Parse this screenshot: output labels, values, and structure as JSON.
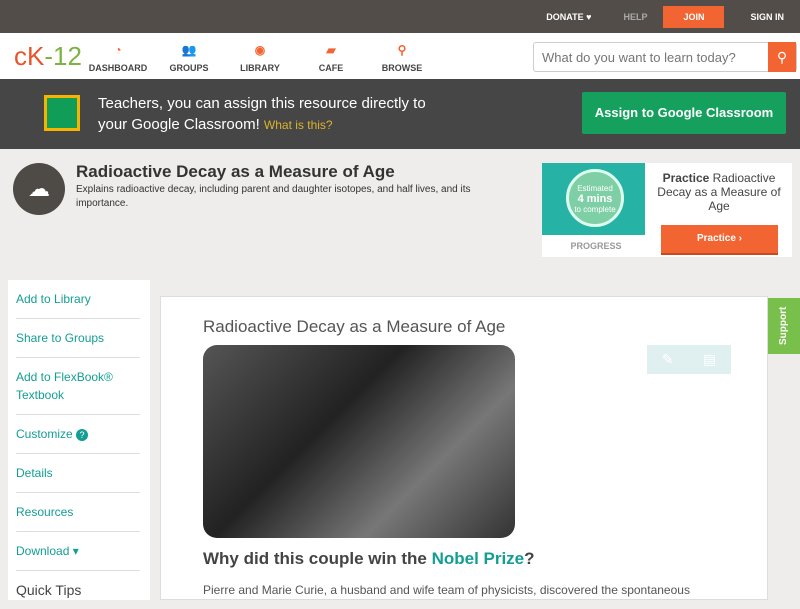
{
  "topbar": {
    "donate": "DONATE ♥",
    "help": "HELP",
    "join": "JOIN",
    "signin": "SIGN IN"
  },
  "logo": {
    "a": "cK",
    "b": "-12"
  },
  "nav": [
    {
      "label": "DASHBOARD",
      "icon": "◔"
    },
    {
      "label": "GROUPS",
      "icon": "👥"
    },
    {
      "label": "LIBRARY",
      "icon": "◉"
    },
    {
      "label": "CAFE",
      "icon": "▰"
    },
    {
      "label": "BROWSE",
      "icon": "⚲"
    }
  ],
  "search": {
    "placeholder": "What do you want to learn today?",
    "icon": "⚲"
  },
  "gbar": {
    "line1": "Teachers, you can assign this resource directly to",
    "line2": "your Google Classroom!",
    "link": "What is this?",
    "button": "Assign to Google Classroom"
  },
  "header": {
    "icon": "☁",
    "title": "Radioactive Decay as a Measure of Age",
    "desc": "Explains radioactive decay, including parent and daughter isotopes, and half lives, and its importance."
  },
  "practice": {
    "est1": "Estimated",
    "est2": "4 mins",
    "est3": "to complete",
    "progress": "PROGRESS",
    "title_bold": "Practice",
    "title": " Radioactive Decay as a Measure of Age",
    "button": "Practice ›"
  },
  "sidebar": {
    "items": [
      "Add to Library",
      "Share to Groups",
      "Add to FlexBook® Textbook",
      "Customize",
      "Details",
      "Resources",
      "Download ▾"
    ],
    "help": "?",
    "quick": "Quick Tips"
  },
  "main": {
    "title": "Radioactive Decay as a Measure of Age",
    "q1": "Why did this couple win the ",
    "q2": "Nobel Prize",
    "q3": "?",
    "para": "Pierre and Marie Curie, a husband and wife team of physicists, discovered the spontaneous",
    "pencil": "✎",
    "note": "▤"
  },
  "support": "Support"
}
